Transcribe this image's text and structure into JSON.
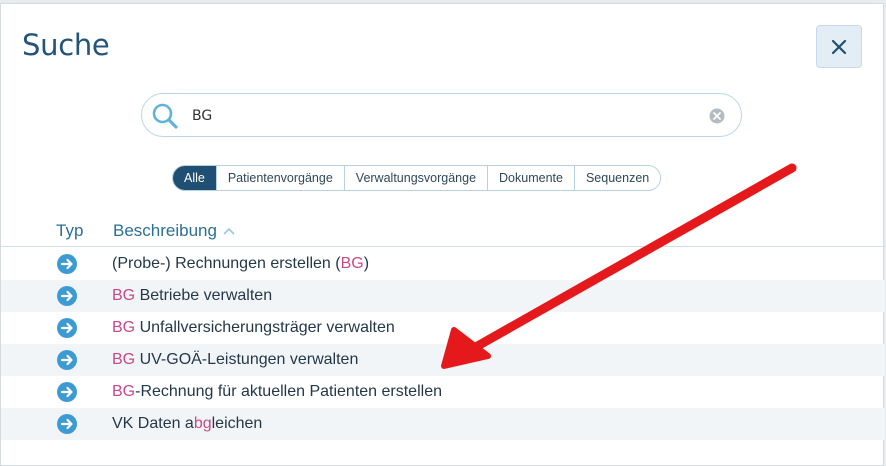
{
  "dialog": {
    "title": "Suche",
    "close_icon": "close-icon"
  },
  "search": {
    "value": "BG",
    "icon": "search-icon",
    "clear_icon": "clear-icon"
  },
  "filters": [
    {
      "label": "Alle",
      "active": true
    },
    {
      "label": "Patientenvorgänge",
      "active": false
    },
    {
      "label": "Verwaltungsvorgänge",
      "active": false
    },
    {
      "label": "Dokumente",
      "active": false
    },
    {
      "label": "Sequenzen",
      "active": false
    }
  ],
  "table": {
    "columns": {
      "typ": "Typ",
      "beschreibung": "Beschreibung"
    },
    "sort_icon": "chevron-up-icon",
    "rows": [
      {
        "icon": "arrow-right-icon",
        "parts": [
          "(Probe-) Rechnungen erstellen (",
          "BG",
          ")"
        ]
      },
      {
        "icon": "arrow-right-icon",
        "parts": [
          "",
          "BG",
          " Betriebe verwalten"
        ]
      },
      {
        "icon": "arrow-right-icon",
        "parts": [
          "",
          "BG",
          " Unfallversicherungsträger verwalten"
        ]
      },
      {
        "icon": "arrow-right-icon",
        "parts": [
          "",
          "BG",
          " UV-GOÄ-Leistungen verwalten"
        ]
      },
      {
        "icon": "arrow-right-icon",
        "parts": [
          "",
          "BG",
          "-Rechnung für aktuellen Patienten erstellen"
        ]
      },
      {
        "icon": "arrow-right-icon",
        "parts": [
          "VK Daten a",
          "bg",
          "leichen"
        ]
      }
    ]
  },
  "colors": {
    "title": "#23557a",
    "accent": "#1f4f73",
    "highlight": "#c8488a",
    "row_icon": "#3d9bd1",
    "annotation_arrow": "#e5191b"
  }
}
